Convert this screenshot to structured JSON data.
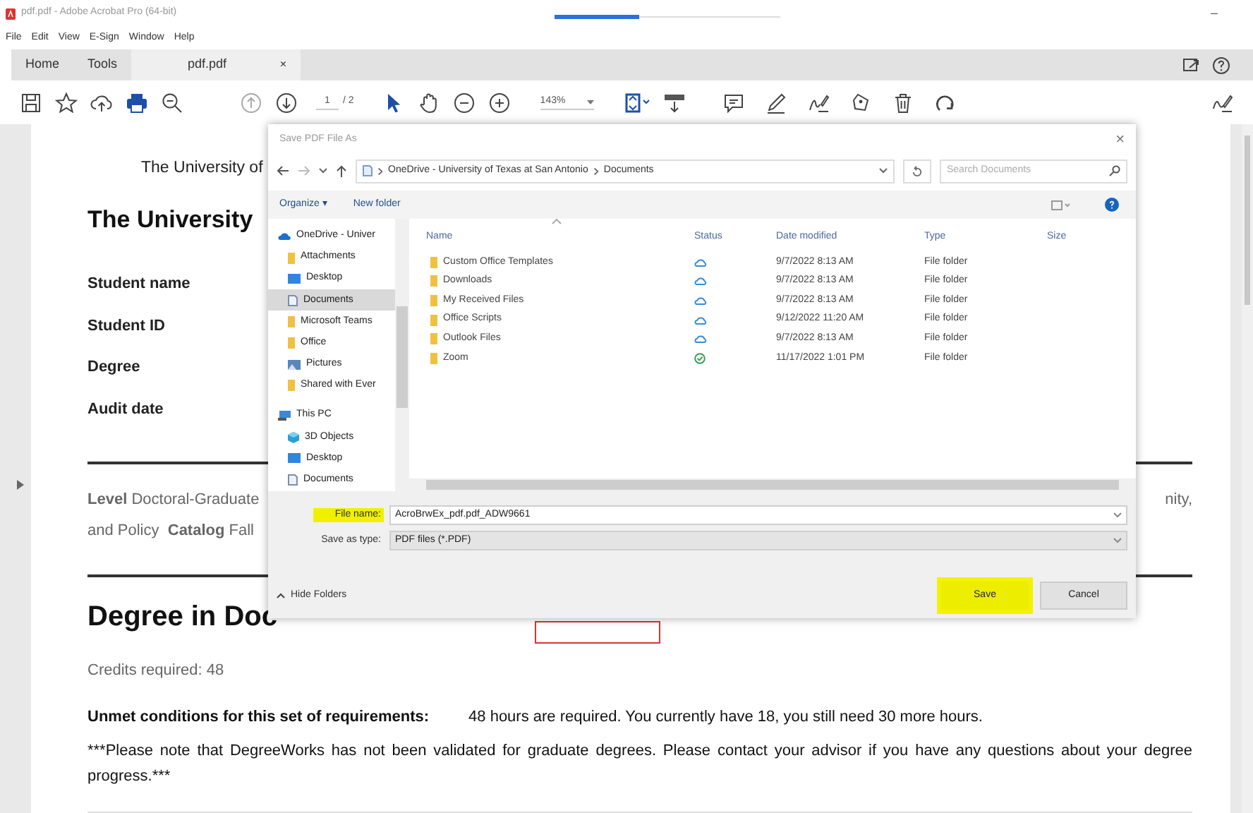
{
  "window": {
    "title": "pdf.pdf - Adobe Acrobat Pro (64-bit)",
    "minimize": "–"
  },
  "menu": [
    "File",
    "Edit",
    "View",
    "E-Sign",
    "Window",
    "Help"
  ],
  "tabs": [
    {
      "label": "Home",
      "selected": false
    },
    {
      "label": "Tools",
      "selected": false
    },
    {
      "label": "pdf.pdf",
      "selected": true,
      "close": "×"
    }
  ],
  "toolbar": {
    "page": "1",
    "page_total": "/ 2",
    "zoom": "143%"
  },
  "document": {
    "header": "The University of",
    "title": "The University",
    "fields": [
      "Student name",
      "Student ID",
      "Degree",
      "Audit date"
    ],
    "level_line": "**Level** Doctoral-Graduate",
    "level_tail": "nity,",
    "catalog_line": "and Policy  **Catalog** Fall",
    "section_title": "Degree in Doc",
    "credits": "Credits required: 48",
    "unmet_label": "Unmet conditions for this set of requirements:",
    "unmet_text": "48 hours are required. You currently have 18, you still need 30 more hours.",
    "note": "***Please note that DegreeWorks has not been validated for graduate degrees. Please contact your advisor if you have any questions about your degree progress.***"
  },
  "dialog": {
    "title": "Save PDF File As",
    "close": "×",
    "path": [
      "OneDrive - University of Texas at San Antonio",
      "Documents"
    ],
    "search": {
      "placeholder": "Search Documents"
    },
    "commands": [
      "Organize ▾",
      "New folder"
    ],
    "nav": [
      {
        "label": "OneDrive - Univer",
        "kind": "onedrive",
        "selected": false,
        "children": [
          {
            "label": "Attachments",
            "kind": "folder",
            "selected": false
          },
          {
            "label": "Desktop",
            "kind": "desktop",
            "selected": false
          },
          {
            "label": "Documents",
            "kind": "documents",
            "selected": true
          },
          {
            "label": "Microsoft Teams",
            "kind": "folder",
            "selected": false
          },
          {
            "label": "Office",
            "kind": "folder",
            "selected": false
          },
          {
            "label": "Pictures",
            "kind": "pictures",
            "selected": false
          },
          {
            "label": "Shared with Ever",
            "kind": "folder",
            "selected": false
          }
        ]
      },
      {
        "label": "This PC",
        "kind": "pc",
        "selected": false,
        "children": [
          {
            "label": "3D Objects",
            "kind": "objects3d",
            "selected": false
          },
          {
            "label": "Desktop",
            "kind": "desktop",
            "selected": false
          },
          {
            "label": "Documents",
            "kind": "documents",
            "selected": false
          }
        ]
      }
    ],
    "columns": [
      "Name",
      "Status",
      "Date modified",
      "Type",
      "Size"
    ],
    "files": [
      {
        "name": "Custom Office Templates",
        "kind": "cloud",
        "date": "9/7/2022 8:13 AM",
        "type": "File folder"
      },
      {
        "name": "Downloads",
        "kind": "cloud",
        "date": "9/7/2022 8:13 AM",
        "type": "File folder"
      },
      {
        "name": "My Received Files",
        "kind": "cloud",
        "date": "9/7/2022 8:13 AM",
        "type": "File folder"
      },
      {
        "name": "Office Scripts",
        "kind": "cloud",
        "date": "9/12/2022 11:20 AM",
        "type": "File folder"
      },
      {
        "name": "Outlook Files",
        "kind": "cloud",
        "date": "9/7/2022 8:13 AM",
        "type": "File folder"
      },
      {
        "name": "Zoom",
        "kind": "synced",
        "date": "11/17/2022 1:01 PM",
        "type": "File folder"
      }
    ],
    "file_name": {
      "label": "File name:",
      "value": "AcroBrwEx_pdf.pdf_ADW9661",
      "highlighted": true
    },
    "save_type": {
      "label": "Save as type:",
      "value": "PDF files (*.PDF)"
    },
    "hide_folders": "Hide Folders",
    "buttons": [
      {
        "label": "Save",
        "highlighted": true
      },
      {
        "label": "Cancel",
        "highlighted": false
      }
    ]
  }
}
